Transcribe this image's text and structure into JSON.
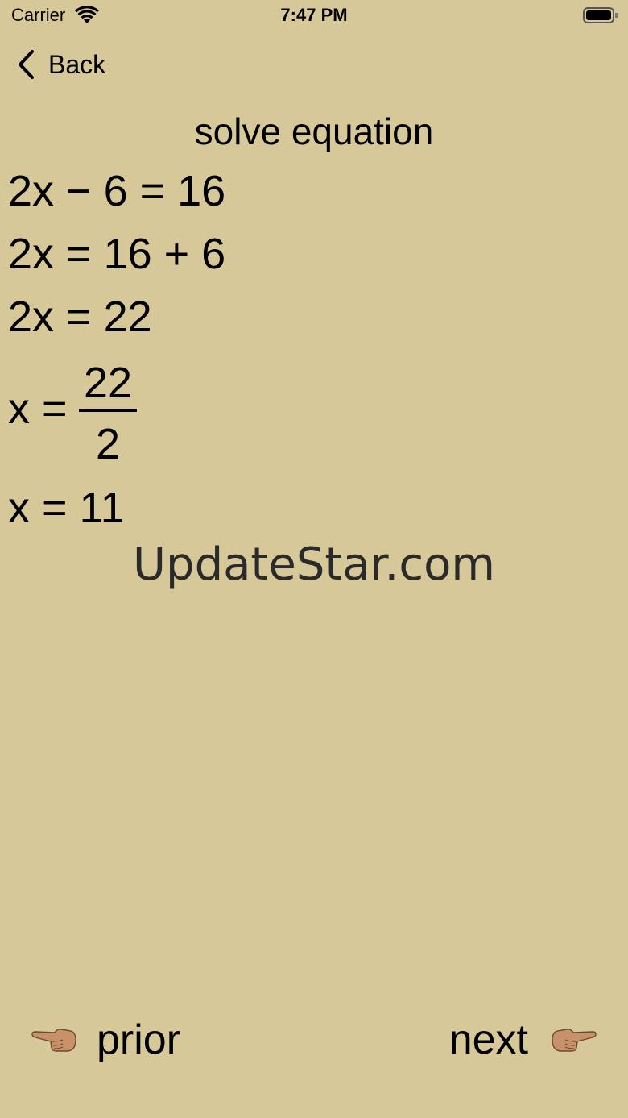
{
  "status_bar": {
    "carrier": "Carrier",
    "time": "7:47 PM",
    "wifi_icon": "wifi-icon",
    "battery_icon": "battery-full-icon"
  },
  "nav": {
    "back_label": "Back",
    "back_icon": "chevron-left-icon"
  },
  "title": "solve equation",
  "steps": [
    "2x − 6 = 16",
    "2x = 16 + 6",
    "2x = 22",
    {
      "lhs": "x =",
      "numerator": "22",
      "denominator": "2"
    },
    "x = 11"
  ],
  "watermark": "UpdateStar.com",
  "footer": {
    "prior_label": "prior",
    "next_label": "next",
    "prior_icon": "hand-pointing-left-icon",
    "next_icon": "hand-pointing-right-icon"
  },
  "colors": {
    "background": "#d7c89a",
    "text": "#000000",
    "skin": "#c8916a"
  }
}
